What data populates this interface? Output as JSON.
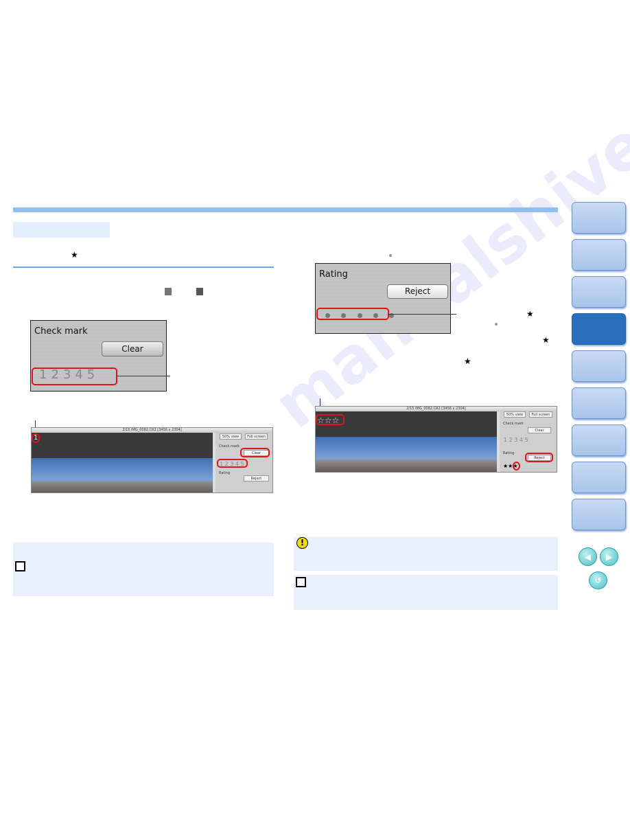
{
  "watermark": "manualshive.com",
  "left": {
    "panel": {
      "title": "Check mark",
      "button": "Clear",
      "numbers": "12345"
    },
    "screenshot": {
      "titlebar": "2/15 IMG_0082.CR2 [3456 x 2304]",
      "view_btn": "50% view",
      "full_btn": "Full screen",
      "check_label": "Check mark",
      "clear_btn": "Clear",
      "numbers": "1 2 3 4 5",
      "rating_label": "Rating",
      "reject_btn": "Reject",
      "overlay_mark": "1"
    }
  },
  "right": {
    "panel": {
      "title": "Rating",
      "button": "Reject"
    },
    "screenshot": {
      "titlebar": "2/15 IMG_0082.CR2 [3456 x 2304]",
      "view_btn": "50% view",
      "full_btn": "Full screen",
      "check_label": "Check mark",
      "clear_btn": "Clear",
      "numbers": "1 2 3 4 5",
      "rating_label": "Rating",
      "reject_btn": "Reject",
      "overlay_stars": "☆☆☆",
      "rating_stars": "★★★"
    }
  },
  "icons": {
    "star": "★",
    "note": "note-icon",
    "caution": "caution-icon"
  },
  "side_tabs": {
    "count": 9,
    "active_index": 3
  },
  "nav": {
    "prev": "◀",
    "next": "▶",
    "back": "↺"
  },
  "colors": {
    "accent": "#8ec0f4",
    "active_tab": "#2a6fbd",
    "highlight": "#e0141a"
  }
}
